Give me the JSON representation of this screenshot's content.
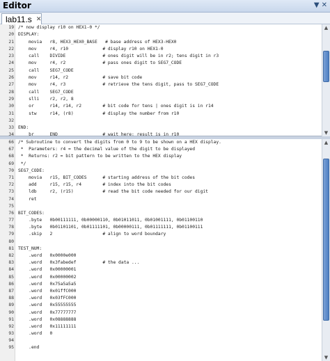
{
  "window": {
    "title": "Editor",
    "controls": [
      "▼",
      "✕"
    ]
  },
  "tab": {
    "label": "lab11.s",
    "close": "✕"
  },
  "top_lines": [
    {
      "n": "19",
      "text": "/* now display r10 on HEX1-0 */",
      "kind": "comment"
    },
    {
      "n": "20",
      "text": "DISPLAY:",
      "kind": "label"
    },
    {
      "n": "21",
      "text": "    movia   r8, HEX3_HEX0_BASE   # base address of HEX3-HEX0",
      "kind": "code"
    },
    {
      "n": "22",
      "text": "    mov     r4, r10             # display r10 on HEX1-0",
      "kind": "code"
    },
    {
      "n": "23",
      "text": "    call    DIVIDE              # ones digit will be in r2; tens digit in r3",
      "kind": "code"
    },
    {
      "n": "24",
      "text": "    mov     r4, r2              # pass ones digit to SEG7_CODE",
      "kind": "code"
    },
    {
      "n": "25",
      "text": "    call    SEG7_CODE",
      "kind": "code"
    },
    {
      "n": "26",
      "text": "    mov     r14, r2             # save bit code",
      "kind": "code"
    },
    {
      "n": "27",
      "text": "    mov     r4, r3              # retrieve the tens digit, pass to SEG7_CODE",
      "kind": "code"
    },
    {
      "n": "28",
      "text": "    call    SEG7_CODE",
      "kind": "code"
    },
    {
      "n": "29",
      "text": "    slli    r2, r2, 8",
      "kind": "code"
    },
    {
      "n": "30",
      "text": "    or      r14, r14, r2        # bit code for tens | ones digit is in r14",
      "kind": "code"
    },
    {
      "n": "31",
      "text": "    stw     r14, (r8)           # display the number from r10",
      "kind": "code"
    },
    {
      "n": "32",
      "text": "",
      "kind": "code"
    },
    {
      "n": "33",
      "text": "END:",
      "kind": "label"
    },
    {
      "n": "34",
      "text": "    br      END                 # wait here; result is in r10",
      "kind": "code"
    }
  ],
  "bottom_lines": [
    {
      "n": "66",
      "text": "/* Subroutine to convert the digits from 0 to 9 to be shown on a HEX display.",
      "kind": "comment"
    },
    {
      "n": "67",
      "text": " *  Parameters: r4 = the decimal value of the digit to be displayed",
      "kind": "comment"
    },
    {
      "n": "68",
      "text": " *  Returns: r2 = bit pattern to be written to the HEX display",
      "kind": "comment"
    },
    {
      "n": "69",
      "text": " */",
      "kind": "comment"
    },
    {
      "n": "70",
      "text": "SEG7_CODE:",
      "kind": "label"
    },
    {
      "n": "71",
      "text": "    movia   r15, BIT_CODES      # starting address of the bit codes",
      "kind": "code"
    },
    {
      "n": "72",
      "text": "    add     r15, r15, r4        # index into the bit codes",
      "kind": "code"
    },
    {
      "n": "73",
      "text": "    ldb     r2, (r15)           # read the bit code needed for our digit",
      "kind": "code"
    },
    {
      "n": "74",
      "text": "    ret",
      "kind": "code"
    },
    {
      "n": "75",
      "text": "",
      "kind": "code"
    },
    {
      "n": "76",
      "text": "BIT_CODES:",
      "kind": "label"
    },
    {
      "n": "77",
      "text": "    .byte   0b00111111, 0b00000110, 0b01011011, 0b01001111, 0b01100110",
      "kind": "code"
    },
    {
      "n": "78",
      "text": "    .byte   0b01101101, 0b01111101, 0b00000111, 0b01111111, 0b01100111",
      "kind": "code"
    },
    {
      "n": "79",
      "text": "    .skip   2                   # align to word boundary",
      "kind": "code"
    },
    {
      "n": "80",
      "text": "",
      "kind": "code"
    },
    {
      "n": "81",
      "text": "TEST_NUM:",
      "kind": "label"
    },
    {
      "n": "82",
      "text": "    .word   0x0000e000",
      "kind": "code"
    },
    {
      "n": "83",
      "text": "    .word   0x3fabedef          # the data ...",
      "kind": "code"
    },
    {
      "n": "84",
      "text": "    .word   0x00000001",
      "kind": "code"
    },
    {
      "n": "85",
      "text": "    .word   0x00000002",
      "kind": "code"
    },
    {
      "n": "86",
      "text": "    .word   0x75a5a5a5",
      "kind": "code"
    },
    {
      "n": "87",
      "text": "    .word   0x01ffC000",
      "kind": "code"
    },
    {
      "n": "88",
      "text": "    .word   0x03fFC000",
      "kind": "code"
    },
    {
      "n": "89",
      "text": "    .word   0x55555555",
      "kind": "code"
    },
    {
      "n": "90",
      "text": "    .word   0x77777777",
      "kind": "code"
    },
    {
      "n": "91",
      "text": "    .word   0x08888888",
      "kind": "code"
    },
    {
      "n": "92",
      "text": "    .word   0x11111111",
      "kind": "code"
    },
    {
      "n": "93",
      "text": "    .word   0",
      "kind": "code"
    },
    {
      "n": "94",
      "text": "",
      "kind": "code"
    },
    {
      "n": "95",
      "text": "    .end",
      "kind": "code"
    }
  ],
  "scroll": {
    "top_thumb_fraction": 0.2,
    "bottom_thumb_fraction": 0.06
  },
  "colors": {
    "title_bar": "#c9d8ec",
    "thumb": "#4e7fc2"
  }
}
